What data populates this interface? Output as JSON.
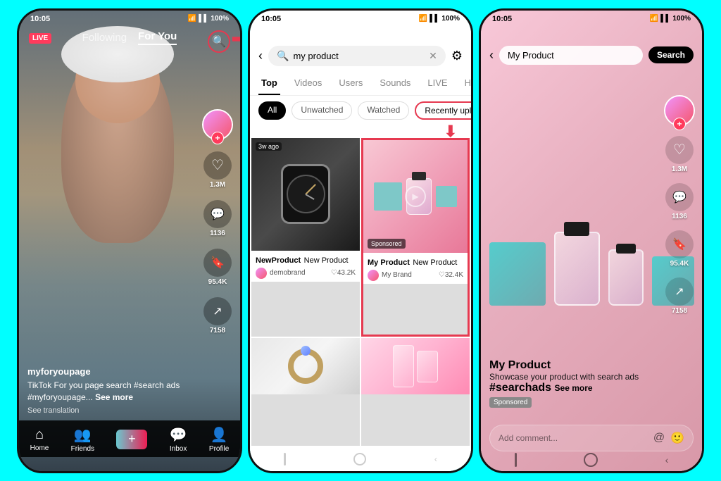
{
  "phone1": {
    "status_time": "10:05",
    "status_signal": "WiFi",
    "status_battery": "100%",
    "live_badge": "LIVE",
    "nav_following": "Following",
    "nav_for_you": "For You",
    "username": "myforyoupage",
    "caption": "TikTok For you page search #search ads",
    "hashtag": "#myforyoupage...",
    "see_more": "See more",
    "see_translation": "See translation",
    "likes": "1.3M",
    "comments": "1136",
    "bookmarks": "95.4K",
    "shares": "7158",
    "bottom_nav": {
      "home": "Home",
      "friends": "Friends",
      "inbox": "Inbox",
      "profile": "Profile"
    }
  },
  "phone2": {
    "status_time": "10:05",
    "status_battery": "100%",
    "search_text": "my product",
    "tabs": [
      "Top",
      "Videos",
      "Users",
      "Sounds",
      "LIVE",
      "Hashtags"
    ],
    "active_tab": "Top",
    "sub_filters": [
      "All",
      "Unwatched",
      "Watched",
      "Recently uploaded"
    ],
    "active_sub": "All",
    "highlighted_sub": "Recently uploaded",
    "items": [
      {
        "title": "NewProduct",
        "subtitle": "New Product",
        "brand": "demobrand",
        "likes": "43.2K",
        "time": "3w ago",
        "sponsored": false
      },
      {
        "title": "My Product",
        "subtitle": "New Product",
        "brand": "My Brand",
        "likes": "32.4K",
        "time": "",
        "sponsored": true
      },
      {
        "title": "",
        "subtitle": "",
        "brand": "",
        "likes": "",
        "time": "",
        "sponsored": false
      },
      {
        "title": "",
        "subtitle": "",
        "brand": "",
        "likes": "",
        "time": "",
        "sponsored": false
      }
    ]
  },
  "phone3": {
    "status_time": "10:05",
    "status_battery": "100%",
    "search_placeholder": "My Product",
    "search_btn": "Search",
    "product_name": "My Product",
    "product_desc": "Showcase your product with search ads",
    "hashtag": "#searchads",
    "see_more": "See more",
    "sponsored": "Sponsored",
    "likes": "1.3M",
    "comments": "1136",
    "bookmarks": "95.4K",
    "shares": "7158",
    "comment_placeholder": "Add comment...",
    "at_symbol": "@",
    "emoji_symbol": "🙂"
  },
  "icons": {
    "search": "🔍",
    "heart": "♡",
    "comment": "💬",
    "bookmark": "🔖",
    "share": "➦",
    "home": "⌂",
    "friends": "👤",
    "add": "+",
    "inbox": "💬",
    "profile": "👤",
    "back": "‹",
    "filter": "⚙",
    "clear": "✕",
    "play": "▶"
  }
}
